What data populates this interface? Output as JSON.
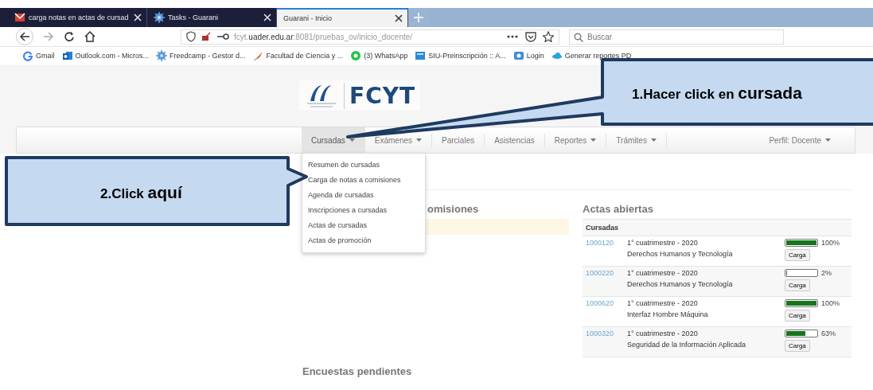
{
  "browser": {
    "tabs": [
      {
        "title": "carga notas en actas de cursad",
        "kind": "mail",
        "selected": false
      },
      {
        "title": "Tasks - Guarani",
        "kind": "gear",
        "selected": false
      },
      {
        "title": "Guarani - Inicio",
        "kind": "plain",
        "selected": true
      }
    ],
    "url": "fcyt.**uader.edu.ar**:8081/pruebas_ov/inicio_docente/",
    "search": {
      "placeholder": "Buscar"
    },
    "bookmarks": [
      {
        "label": "Gmail",
        "kind": "google"
      },
      {
        "label": "Outlook.com - Micros...",
        "kind": "outlook"
      },
      {
        "label": "Freedcamp - Gestor d...",
        "kind": "gear"
      },
      {
        "label": "Facultad de Ciencia y ...",
        "kind": "feather"
      },
      {
        "label": "(3) WhatsApp",
        "kind": "whatsapp"
      },
      {
        "label": "SIU-Preinscripción :: A...",
        "kind": "siu"
      },
      {
        "label": "Login",
        "kind": "login"
      },
      {
        "label": "Generar reportes PD",
        "kind": "cloud"
      }
    ]
  },
  "header": {
    "logo_text": "FCYT"
  },
  "menu": {
    "items": [
      {
        "label": "Cursadas",
        "has_dropdown": true,
        "selected": true
      },
      {
        "label": "Exámenes",
        "has_dropdown": true,
        "selected": false
      },
      {
        "label": "Parciales",
        "has_dropdown": false,
        "selected": false
      },
      {
        "label": "Asistencias",
        "has_dropdown": false,
        "selected": false
      },
      {
        "label": "Reportes",
        "has_dropdown": true,
        "selected": false
      },
      {
        "label": "Trámites",
        "has_dropdown": true,
        "selected": false
      }
    ],
    "profile": "Perfil: Docente"
  },
  "dropdown": [
    "Resumen de cursadas",
    "Carga de notas a comisiones",
    "Agenda de cursadas",
    "Inscripciones a cursadas",
    "Actas de cursadas",
    "Actas de promoción"
  ],
  "left_panel": {
    "title": "omisiones"
  },
  "actas": {
    "title": "Actas abiertas",
    "header": "Cursadas",
    "rows": [
      {
        "code": "1000120",
        "period": "1° cuatrimestre - 2020",
        "subject": "Derechos Humanos y Tecnología",
        "level": 1,
        "percent": "100%",
        "button": "Carga"
      },
      {
        "code": "1000220",
        "period": "1° cuatrimestre - 2020",
        "subject": "Derechos Humanos y Tecnología",
        "level": 0.02,
        "percent": "2%",
        "button": "Carga"
      },
      {
        "code": "1000620",
        "period": "1° cuatrimestre - 2020",
        "subject": "Interfaz Hombre Máquina",
        "level": 1,
        "percent": "100%",
        "button": "Carga"
      },
      {
        "code": "1000320",
        "period": "1° cuatrimestre - 2020",
        "subject": "Seguridad de la Información Aplicada",
        "level": 0.63,
        "percent": "63%",
        "button": "Carga"
      }
    ]
  },
  "encuestas": {
    "title": "Encuestas pendientes"
  },
  "callouts": [
    {
      "text": "1.Hacer click en",
      "emphasis": "cursada"
    },
    {
      "text": "2.Click",
      "emphasis": "aquí"
    }
  ]
}
